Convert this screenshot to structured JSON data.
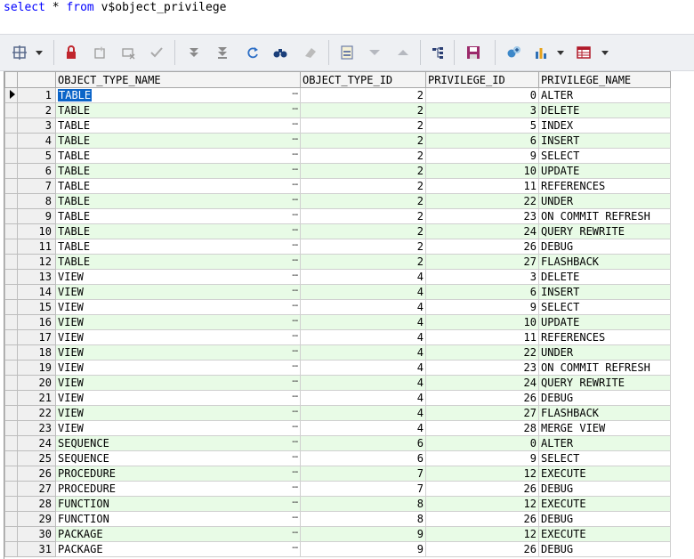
{
  "query": {
    "keyword1": "select",
    "rest1": " * ",
    "keyword2": "from",
    "rest2": " v$object_privilege"
  },
  "toolbar": {
    "icons": [
      "grid-options-icon",
      "dropdown-arrow-icon",
      "lock-icon",
      "insert-record-icon",
      "delete-record-icon",
      "post-edit-icon",
      "first-record-icon",
      "last-record-icon",
      "refresh-icon",
      "find-icon",
      "clear-icon",
      "single-record-view-icon",
      "filter-down-icon",
      "filter-up-icon",
      "tree-view-icon",
      "save-icon",
      "query-plan-icon",
      "chart-icon",
      "export-icon"
    ]
  },
  "columns": [
    "OBJECT_TYPE_NAME",
    "OBJECT_TYPE_ID",
    "PRIVILEGE_ID",
    "PRIVILEGE_NAME"
  ],
  "ellipsis": "…",
  "rows": [
    [
      "1",
      "TABLE",
      "2",
      "0",
      "ALTER"
    ],
    [
      "2",
      "TABLE",
      "2",
      "3",
      "DELETE"
    ],
    [
      "3",
      "TABLE",
      "2",
      "5",
      "INDEX"
    ],
    [
      "4",
      "TABLE",
      "2",
      "6",
      "INSERT"
    ],
    [
      "5",
      "TABLE",
      "2",
      "9",
      "SELECT"
    ],
    [
      "6",
      "TABLE",
      "2",
      "10",
      "UPDATE"
    ],
    [
      "7",
      "TABLE",
      "2",
      "11",
      "REFERENCES"
    ],
    [
      "8",
      "TABLE",
      "2",
      "22",
      "UNDER"
    ],
    [
      "9",
      "TABLE",
      "2",
      "23",
      "ON COMMIT REFRESH"
    ],
    [
      "10",
      "TABLE",
      "2",
      "24",
      "QUERY REWRITE"
    ],
    [
      "11",
      "TABLE",
      "2",
      "26",
      "DEBUG"
    ],
    [
      "12",
      "TABLE",
      "2",
      "27",
      "FLASHBACK"
    ],
    [
      "13",
      "VIEW",
      "4",
      "3",
      "DELETE"
    ],
    [
      "14",
      "VIEW",
      "4",
      "6",
      "INSERT"
    ],
    [
      "15",
      "VIEW",
      "4",
      "9",
      "SELECT"
    ],
    [
      "16",
      "VIEW",
      "4",
      "10",
      "UPDATE"
    ],
    [
      "17",
      "VIEW",
      "4",
      "11",
      "REFERENCES"
    ],
    [
      "18",
      "VIEW",
      "4",
      "22",
      "UNDER"
    ],
    [
      "19",
      "VIEW",
      "4",
      "23",
      "ON COMMIT REFRESH"
    ],
    [
      "20",
      "VIEW",
      "4",
      "24",
      "QUERY REWRITE"
    ],
    [
      "21",
      "VIEW",
      "4",
      "26",
      "DEBUG"
    ],
    [
      "22",
      "VIEW",
      "4",
      "27",
      "FLASHBACK"
    ],
    [
      "23",
      "VIEW",
      "4",
      "28",
      "MERGE VIEW"
    ],
    [
      "24",
      "SEQUENCE",
      "6",
      "0",
      "ALTER"
    ],
    [
      "25",
      "SEQUENCE",
      "6",
      "9",
      "SELECT"
    ],
    [
      "26",
      "PROCEDURE",
      "7",
      "12",
      "EXECUTE"
    ],
    [
      "27",
      "PROCEDURE",
      "7",
      "26",
      "DEBUG"
    ],
    [
      "28",
      "FUNCTION",
      "8",
      "12",
      "EXECUTE"
    ],
    [
      "29",
      "FUNCTION",
      "8",
      "26",
      "DEBUG"
    ],
    [
      "30",
      "PACKAGE",
      "9",
      "12",
      "EXECUTE"
    ],
    [
      "31",
      "PACKAGE",
      "9",
      "26",
      "DEBUG"
    ]
  ],
  "colors": {
    "alt_row": "#e8fbe6",
    "selection": "#0a64c8",
    "keyword": "#0000ff"
  }
}
